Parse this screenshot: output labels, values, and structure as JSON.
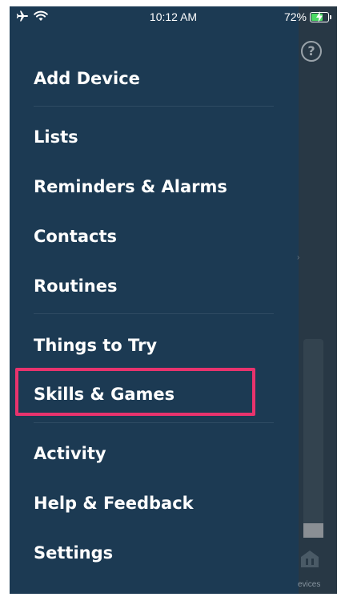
{
  "status_bar": {
    "time": "10:12 AM",
    "battery_text": "72%",
    "battery_level": 0.72,
    "icons": [
      "airplane-icon",
      "wifi-icon",
      "battery-icon"
    ]
  },
  "menu": {
    "items": [
      {
        "label": "Add Device"
      },
      {
        "label": "Lists"
      },
      {
        "label": "Reminders & Alarms"
      },
      {
        "label": "Contacts"
      },
      {
        "label": "Routines"
      },
      {
        "label": "Things to Try"
      },
      {
        "label": "Skills & Games",
        "highlighted": true
      },
      {
        "label": "Activity"
      },
      {
        "label": "Help & Feedback"
      },
      {
        "label": "Settings"
      }
    ]
  },
  "background": {
    "help_glyph": "?",
    "devices_label": "evices"
  },
  "colors": {
    "menu_bg": "#1c3a53",
    "highlight": "#e8336d",
    "battery_fill": "#4cd964",
    "text": "#ffffff"
  }
}
